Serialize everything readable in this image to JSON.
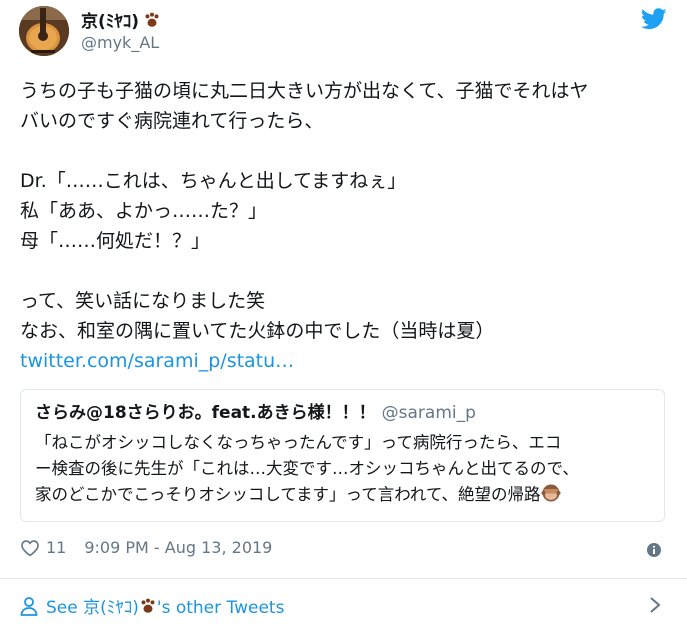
{
  "author": {
    "display_name": "京(ﾐﾔｺ)",
    "handle": "@myk_AL",
    "avatar_icon": "guitar-avatar",
    "name_emoji": "paw-prints-icon"
  },
  "tweet": {
    "lines": [
      "うちの子も子猫の頃に丸二日大きい方が出なくて、子猫でそれはヤ",
      "バいのですぐ病院連れて行ったら、",
      "",
      "Dr.「……これは、ちゃんと出してますねぇ」",
      "私「ああ、よかっ……た？」",
      "母「……何処だ！？」",
      "",
      "って、笑い話になりました笑",
      "なお、和室の隅に置いてた火鉢の中でした（当時は夏）"
    ],
    "link": "twitter.com/sarami_p/statu…"
  },
  "quote": {
    "name": "さらみ@18さらりお。feat.あきら様！！！",
    "handle": "@sarami_p",
    "text_lines": [
      "「ねこがオシッコしなくなっちゃったんです」って病院行ったら、エコ",
      "ー検査の後に先生が「これは…大変です…オシッコちゃんと出てるので、",
      "家のどこかでこっそりオシッコしてます」って言われて、絶望の帰路"
    ],
    "emoji": "see-no-evil-monkey-icon"
  },
  "meta": {
    "likes": "11",
    "timestamp": "9:09 PM - Aug 13, 2019"
  },
  "footer": {
    "see_prefix": "See ",
    "see_name": "京(ﾐﾔｺ)",
    "see_suffix": "'s other Tweets"
  },
  "colors": {
    "link": "#1b95e0",
    "muted": "#657786",
    "border": "#e1e8ed",
    "paw": "#7a3b1a"
  }
}
